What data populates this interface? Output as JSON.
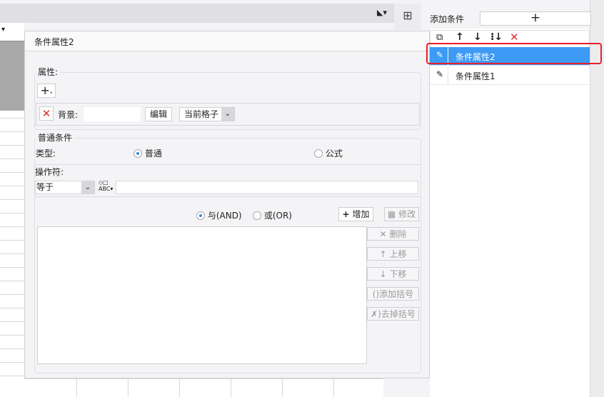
{
  "dialog": {
    "title": "条件属性2",
    "attributes": {
      "legend": "属性:",
      "add_icon": "plus-icon",
      "background_label": "背景:",
      "background_value": "",
      "edit_label": "编辑",
      "scope_value": "当前格子"
    },
    "condition": {
      "legend": "普通条件",
      "type_label": "类型:",
      "type_normal": "普通",
      "type_formula": "公式",
      "operator_label": "操作符:",
      "operator_value": "等于",
      "value": "",
      "and_label": "与(AND)",
      "or_label": "或(OR)",
      "add_label": "增加",
      "modify_label": "修改",
      "delete_label": "删除",
      "up_label": "上移",
      "down_label": "下移",
      "add_paren_label": "添加括号",
      "remove_paren_label": "去掉括号"
    }
  },
  "panel": {
    "add_condition_label": "添加条件",
    "items": [
      {
        "label": "条件属性2",
        "selected": true
      },
      {
        "label": "条件属性1",
        "selected": false
      }
    ]
  },
  "colors": {
    "selected": "#3d9af5",
    "highlight": "#e8202a",
    "delete": "#e03030"
  }
}
